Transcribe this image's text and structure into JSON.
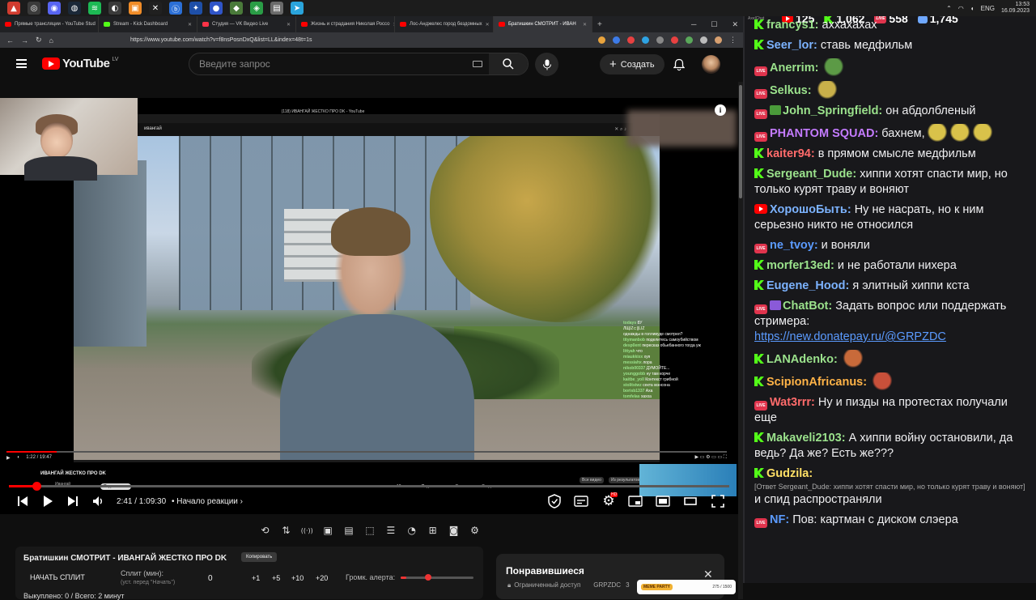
{
  "taskbar": {
    "icons": [
      {
        "name": "app-icon-1",
        "color": "#d13c2f",
        "glyph": "▲"
      },
      {
        "name": "app-icon-2",
        "color": "#3b3b3b",
        "glyph": "◎"
      },
      {
        "name": "discord-icon",
        "color": "#5865f2",
        "glyph": "◉"
      },
      {
        "name": "steam-icon",
        "color": "#1b2838",
        "glyph": "◍"
      },
      {
        "name": "spotify-icon",
        "color": "#1db954",
        "glyph": "≋"
      },
      {
        "name": "chrome-icon",
        "color": "#3a3a3a",
        "glyph": "◐"
      },
      {
        "name": "app-icon-7",
        "color": "#f08c28",
        "glyph": "▣"
      },
      {
        "name": "app-icon-8",
        "color": "#202020",
        "glyph": "✕"
      },
      {
        "name": "app-icon-9",
        "color": "#2b6fd6",
        "glyph": "ⓑ"
      },
      {
        "name": "app-icon-10",
        "color": "#1e4fa8",
        "glyph": "✦"
      },
      {
        "name": "app-icon-11",
        "color": "#3055c8",
        "glyph": "●"
      },
      {
        "name": "app-icon-12",
        "color": "#4a7a3a",
        "glyph": "◆"
      },
      {
        "name": "app-icon-13",
        "color": "#2a9d46",
        "glyph": "◈"
      },
      {
        "name": "app-icon-14",
        "color": "#6a6a6a",
        "glyph": "▤"
      },
      {
        "name": "telegram-icon",
        "color": "#2aa4dc",
        "glyph": "➤"
      }
    ],
    "tray_lang": "ENG",
    "time": "13:53",
    "date": "16.09.2023"
  },
  "browser": {
    "tabs": [
      {
        "title": "Прямые трансляции - YouTube Stud",
        "color": "#ff0000",
        "active": false
      },
      {
        "title": "Stream - Kick Dashboard",
        "color": "#53fc18",
        "active": false
      },
      {
        "title": "Студия — VK Видео Live",
        "color": "#ff3347",
        "active": false
      },
      {
        "title": "Жизнь и страдания Николая Россо",
        "color": "#ff0000",
        "active": false
      },
      {
        "title": "Лос-Анджелес город бездомных",
        "color": "#ff0000",
        "active": false
      },
      {
        "title": "Братишкин СМОТРИТ - ИВАН",
        "color": "#ff0000",
        "active": true
      }
    ],
    "url": "https://www.youtube.com/watch?v=f8nsPosnDxQ&list=LL&index=48t=1s"
  },
  "youtube": {
    "logo_text": "YouTube",
    "logo_country": "LV",
    "search_placeholder": "Введите запрос",
    "create_label": "Создать"
  },
  "video": {
    "nested": {
      "tab_title": "(118) ИВАНГАЙ ЖЕСТКО ПРО DK - YouTube",
      "search_value": "ивангай",
      "title": "ИВАНГАЙ ЖЕСТКО ПРО DK",
      "time": "1:22 / 19:47",
      "channel": "Ивангай",
      "subscribe": "Подписаться",
      "actions": [
        "12 тыс.",
        "Поделиться",
        "Скачать",
        "Создать клип"
      ],
      "chips": [
        "Все видео",
        "Из результатов"
      ]
    },
    "overlay_chat": [
      {
        "user": "todays",
        "text": "8У"
      },
      {
        "user": "",
        "text": "ЛЩIZ⊂||LIZ"
      },
      {
        "user": "",
        "text": "однажды в голливуде смотрел?"
      },
      {
        "user": "titymanbob",
        "text": "поделитесь самоубийством"
      },
      {
        "user": "desp0ent",
        "text": "пересказ обьебанного тогда уж"
      },
      {
        "user": "littyah",
        "text": "что"
      },
      {
        "user": "miaukkixx",
        "text": "хуя"
      },
      {
        "user": "messiahx",
        "text": "лора"
      },
      {
        "user": "nikob00337",
        "text": "ДУМОЙТЕ..."
      },
      {
        "user": "younggobb",
        "text": "ну там корче"
      },
      {
        "user": "kaitbe_yoll",
        "text": "Контекст грибной"
      },
      {
        "user": "stolitstwz",
        "text": "секта мэнсона"
      },
      {
        "user": "borisb1337",
        "text": "Аха"
      },
      {
        "user": "tomfelas",
        "text": "хахха"
      }
    ],
    "progress_fraction": 0.0382,
    "time": "2:41 / 1:09:30",
    "chapter": "• Начало реакции"
  },
  "toolbar_icons": [
    "repeat-icon",
    "sort-icon",
    "broadcast-icon",
    "camera-icon",
    "film-icon",
    "screenshot-icon",
    "frames-icon",
    "speed-icon",
    "add-clip-icon",
    "snapshot-icon",
    "settings-icon"
  ],
  "split_panel": {
    "title": "Братишкин СМОТРИТ - ИВАНГАЙ ЖЕСТКО ПРО DK",
    "copy_label": "Копировать",
    "start_label": "НАЧАТЬ СПЛИТ",
    "split_label": "Сплит (мин):",
    "split_hint": "(уст. перед \"Начать\")",
    "split_value": "0",
    "increments": [
      "+1",
      "+5",
      "+10",
      "+20"
    ],
    "alert_label": "Громк. алерта:",
    "alert_fraction": 0.08,
    "bought": "Выкуплено: 0 / Всего: 2 минут"
  },
  "liked_panel": {
    "title": "Понравившиеся",
    "access": "Ограниченный доступ",
    "channel": "GRPZDC",
    "count": "3",
    "meme_label": "MEME PARTY",
    "meme_progress": "275 / 1500"
  },
  "chat": {
    "app_label": "AxelChat",
    "stats": {
      "youtube": "125",
      "kick": "1,062",
      "vk": "558",
      "viewers": "1,745"
    },
    "messages": [
      {
        "src": "kick",
        "user": "francys1",
        "color": "#9be28c",
        "text": "аххахахах",
        "emote": ""
      },
      {
        "src": "kick",
        "user": "Seer_lor",
        "color": "#7cb3ff",
        "text": "ставь медфильм",
        "emote": ""
      },
      {
        "src": "vk",
        "user": "Anerrim",
        "color": "#9be28c",
        "text": "",
        "emote": "#5c9a46"
      },
      {
        "src": "vk",
        "user": "Selkus",
        "color": "#9be28c",
        "text": "",
        "emote": "#c9b04a"
      },
      {
        "src": "vk",
        "user": "John_Springfield",
        "color": "#9be28c",
        "text": "он абдолбленый",
        "emote": "",
        "extra": "#4a9a3a"
      },
      {
        "src": "vk",
        "user": "PHANTOM SQUAD",
        "color": "#c47bff",
        "text": "бахнем,",
        "emote": "#d9c24a",
        "emote_count": 3
      },
      {
        "src": "kick",
        "user": "kaiter94",
        "color": "#ff6b6b",
        "text": "в прямом смысле медфильм",
        "emote": ""
      },
      {
        "src": "kick",
        "user": "Sergeant_Dude",
        "color": "#9be28c",
        "text": "хиппи хотят спасти мир, но только курят траву и воняют",
        "emote": ""
      },
      {
        "src": "yt",
        "user": "ХорошоБыть",
        "color": "#7cb3ff",
        "text": "Ну не насрать, но к ним серьезно никто не относился",
        "emote": ""
      },
      {
        "src": "vk",
        "user": "ne_tvoy",
        "color": "#5b9bff",
        "text": "и воняли",
        "emote": ""
      },
      {
        "src": "kick",
        "user": "morfer13ed",
        "color": "#9be28c",
        "text": "и не работали нихера",
        "emote": ""
      },
      {
        "src": "kick",
        "user": "Eugene_Hood",
        "color": "#7cb3ff",
        "text": "я элитный хиппи кста",
        "emote": ""
      },
      {
        "src": "vk",
        "user": "ChatBot",
        "color": "#9be28c",
        "text": "Задать вопрос или поддержать стримера:",
        "link": "https://new.donatepay.ru/@GRPZDC",
        "extra": "#8a5ad8"
      },
      {
        "src": "kick",
        "user": "LANAdenko",
        "color": "#9be28c",
        "text": "",
        "emote": "#c86a3a"
      },
      {
        "src": "kick",
        "user": "ScipionAfricanus",
        "color": "#ffb347",
        "text": "",
        "emote": "#c8503a"
      },
      {
        "src": "vk",
        "user": "Wat3rrr",
        "color": "#ff6b6b",
        "text": "Ну и пизды на протестах получали еще",
        "emote": ""
      },
      {
        "src": "kick",
        "user": "Makaveli2103",
        "color": "#9be28c",
        "text": "А хиппи войну остановили, да ведь? Да же? Есть же???",
        "emote": ""
      },
      {
        "src": "kick",
        "user": "Gudzila",
        "color": "#ffe066",
        "text": "",
        "reply": "[Ответ Sergeant_Dude: хиппи хотят спасти мир, но только курят траву и воняют]",
        "after": "и спид распространяли"
      },
      {
        "src": "vk",
        "user": "NF",
        "color": "#5b9bff",
        "text": "Пов: картман с диском слэера",
        "emote": ""
      }
    ]
  }
}
